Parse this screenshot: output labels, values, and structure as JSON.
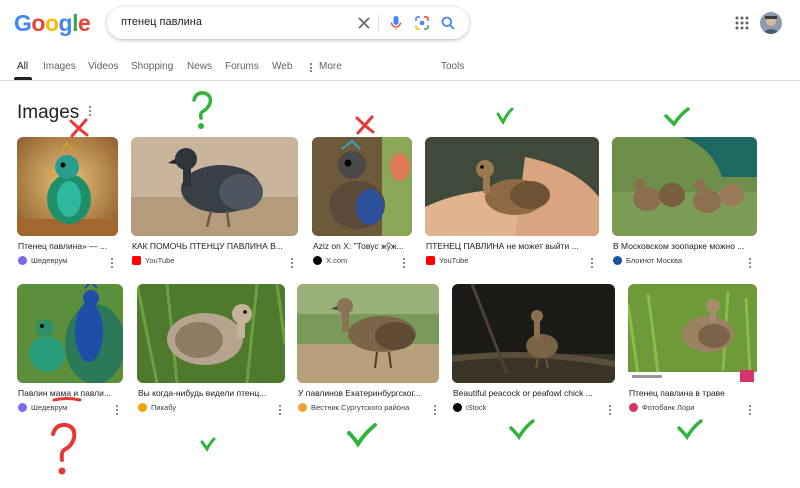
{
  "brand": {
    "logo": "Google",
    "logo_letters": [
      {
        "ch": "G",
        "color": "#4285F4"
      },
      {
        "ch": "o",
        "color": "#EA4335"
      },
      {
        "ch": "o",
        "color": "#FBBC05"
      },
      {
        "ch": "g",
        "color": "#4285F4"
      },
      {
        "ch": "l",
        "color": "#34A853"
      },
      {
        "ch": "e",
        "color": "#EA4335"
      }
    ]
  },
  "search": {
    "query": "птенец павлина"
  },
  "tabs": [
    {
      "label": "All",
      "active": true
    },
    {
      "label": "Images"
    },
    {
      "label": "Videos"
    },
    {
      "label": "Shopping"
    },
    {
      "label": "News"
    },
    {
      "label": "Forums"
    },
    {
      "label": "Web"
    },
    {
      "label": "More"
    },
    {
      "label": "Tools"
    }
  ],
  "section": {
    "title": "Images"
  },
  "row1": [
    {
      "caption": "Птенец павлина» — ...",
      "source": "Шедеврум",
      "source_color": "#7b68ee"
    },
    {
      "caption": "КАК ПОМОЧЬ ПТЕНЦУ ПАВЛИНА В...",
      "source": "YouTube",
      "source_color": "#ff0000"
    },
    {
      "caption": "Aziz on X: \"Товус жўж...",
      "source": "X.com",
      "source_color": "#000000"
    },
    {
      "caption": "ПТЕНЕЦ ПАВЛИНА не может выйти ...",
      "source": "YouTube",
      "source_color": "#ff0000"
    },
    {
      "caption": "В Московском зоопарке можно ...",
      "source": "Блокнот Москва",
      "source_color": "#1a4fa0"
    }
  ],
  "row2": [
    {
      "caption": "Павлин мама и павли...",
      "source": "Шедеврум",
      "source_color": "#7b68ee"
    },
    {
      "caption": "Вы когда-нибудь видели птенц...",
      "source": "Пикабу",
      "source_color": "#f4a300"
    },
    {
      "caption": "У павлинов Екатеринбургског...",
      "source": "Вестник Сургутского района",
      "source_color": "#f0a030"
    },
    {
      "caption": "Beautiful peacock or peafowl chick ...",
      "source": "iStock",
      "source_color": "#000000"
    },
    {
      "caption": "Птенец павлина в траве",
      "source": "Фотобанк Лори",
      "source_color": "#d6336c"
    }
  ],
  "annotations": {
    "row1": [
      "x",
      "?",
      "x",
      "check",
      "check"
    ],
    "row2": [
      "?",
      "check",
      "check",
      "check",
      "check"
    ],
    "colors": {
      "x": "#e53935",
      "question": "#2fb53a",
      "check": "#2fb53a"
    }
  }
}
